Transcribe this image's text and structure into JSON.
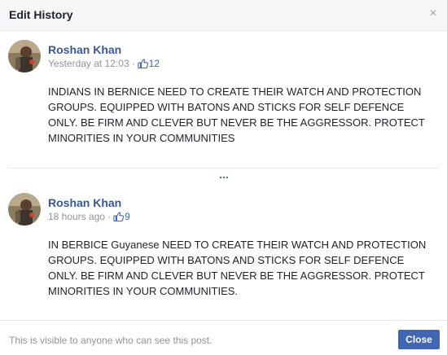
{
  "dialog": {
    "title": "Edit History",
    "close_icon": "close-icon"
  },
  "entries": [
    {
      "author": "Roshan Khan",
      "timestamp": "Yesterday at 12:03",
      "separator": "·",
      "likes": "12",
      "text": "INDIANS IN BERNICE NEED TO CREATE THEIR WATCH AND PROTECTION GROUPS. EQUIPPED WITH BATONS AND STICKS FOR SELF DEFENCE ONLY. BE FIRM AND CLEVER BUT NEVER BE THE AGGRESSOR. PROTECT MINORITIES IN YOUR COMMUNITIES"
    },
    {
      "author": "Roshan Khan",
      "timestamp": "18 hours ago",
      "separator": "·",
      "likes": "9",
      "text": "IN BERBICE Guyanese NEED TO CREATE THEIR WATCH AND PROTECTION GROUPS. EQUIPPED WITH BATONS AND STICKS FOR SELF DEFENCE ONLY. BE FIRM AND CLEVER BUT NEVER BE THE AGGRESSOR. PROTECT MINORITIES IN YOUR COMMUNITIES."
    }
  ],
  "more": {
    "label": "..."
  },
  "footer": {
    "note": "This is visible to anyone who can see this post.",
    "close_label": "Close"
  },
  "colors": {
    "link": "#365899",
    "button": "#4267b2",
    "muted": "#90949c"
  }
}
